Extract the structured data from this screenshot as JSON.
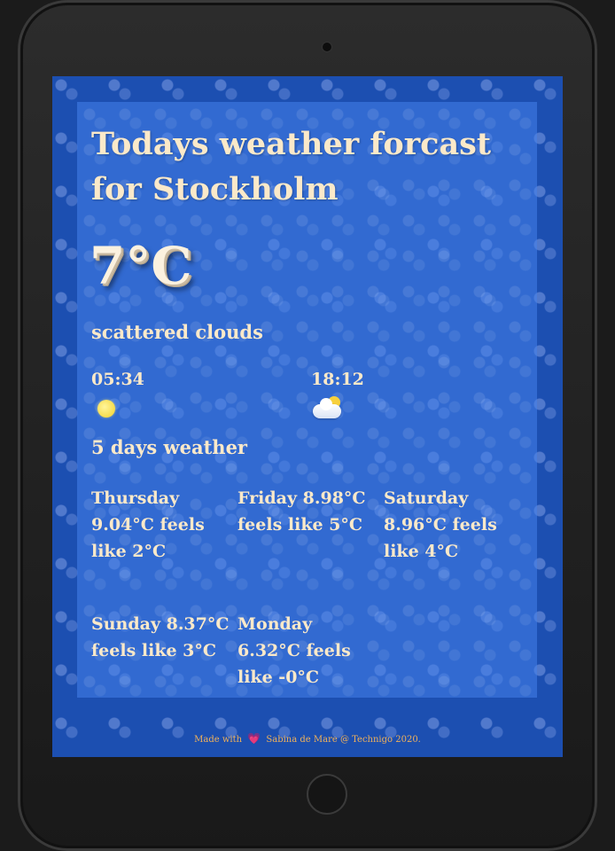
{
  "title": "Todays weather forcast for Stockholm",
  "current": {
    "temperature": "7°C",
    "description": "scattered clouds"
  },
  "sun": {
    "sunrise": "05:34",
    "sunrise_icon": "sun-icon",
    "sunset": "18:12",
    "sunset_icon": "cloud-sun-icon"
  },
  "forecast": {
    "heading": "5 days weather",
    "days": [
      {
        "text": "Thursday 9.04°C feels like 2°C"
      },
      {
        "text": "Friday 8.98°C feels like 5°C"
      },
      {
        "text": "Saturday 8.96°C feels like 4°C"
      },
      {
        "text": "Sunday 8.37°C feels like 3°C"
      },
      {
        "text": "Monday 6.32°C feels like -0°C"
      }
    ]
  },
  "footer": {
    "prefix": "Made with",
    "heart": "💗",
    "suffix": "Sabina de Mare @ Technigo 2020."
  },
  "colors": {
    "background": "#1c4fb1",
    "text": "#fbe9c9",
    "footer_text": "#f0b15a"
  }
}
